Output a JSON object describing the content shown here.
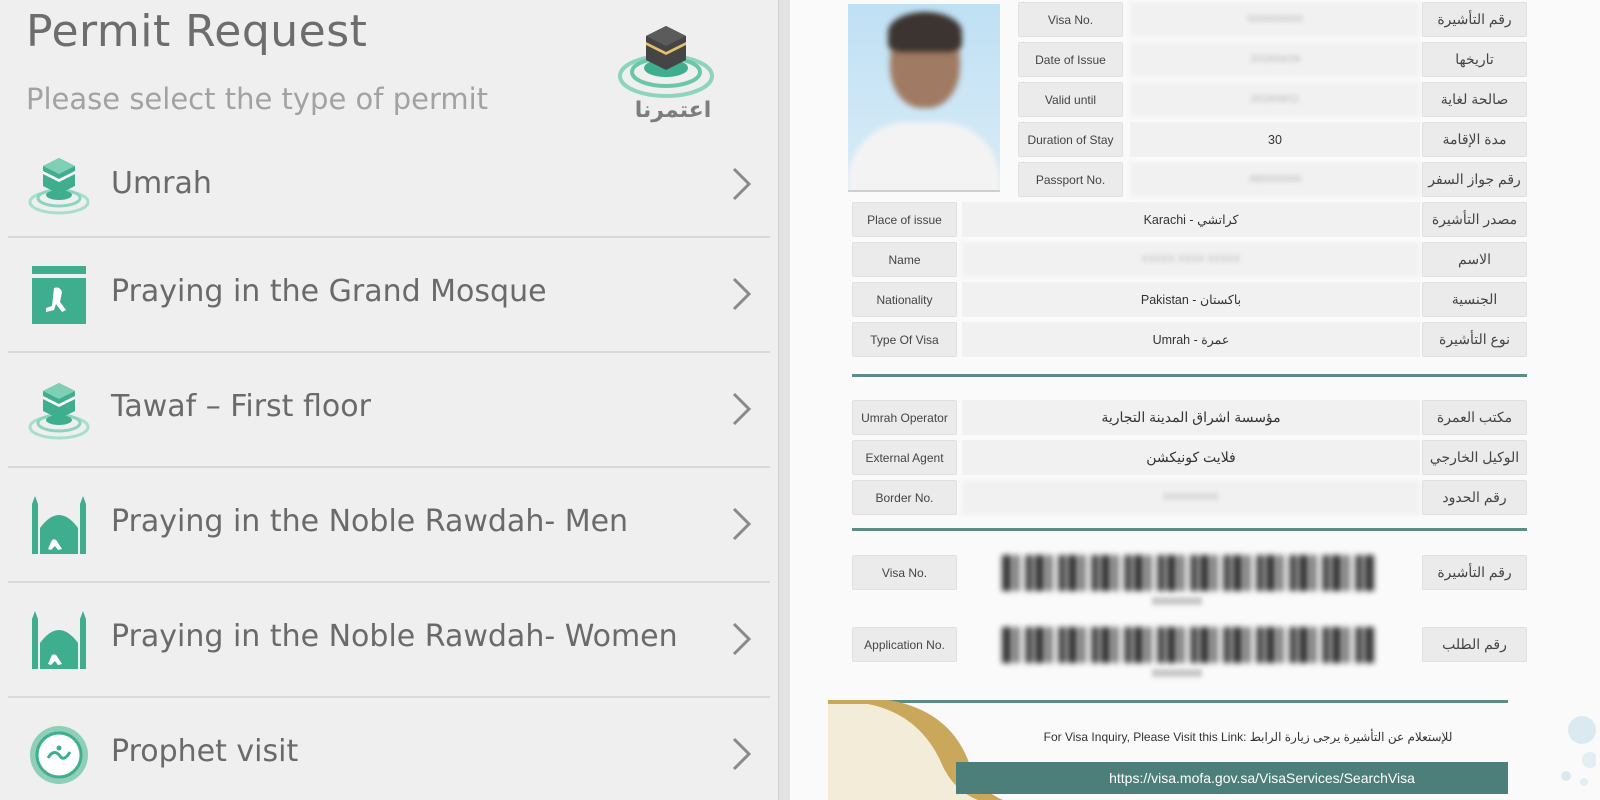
{
  "left": {
    "title": "Permit Request",
    "subtitle": "Please select the type of permit",
    "logo_text": "اعتمرنا",
    "permits": [
      {
        "label": "Umrah",
        "icon": "kaaba-icon"
      },
      {
        "label": "Praying in the Grand Mosque",
        "icon": "prayer-icon"
      },
      {
        "label": "Tawaf – First floor",
        "icon": "kaaba-icon"
      },
      {
        "label": "Praying in the Noble Rawdah- Men",
        "icon": "mosque-icon"
      },
      {
        "label": "Praying in the Noble Rawdah- Women",
        "icon": "mosque-icon"
      },
      {
        "label": "Prophet visit",
        "icon": "prophet-seal-icon"
      }
    ]
  },
  "visa": {
    "fields_top": [
      {
        "en": "Visa No.",
        "ar": "رقم التأشيرة",
        "value": "0000000000"
      },
      {
        "en": "Date of Issue",
        "ar": "تاريخها",
        "value": "2018/04/28"
      },
      {
        "en": "Valid until",
        "ar": "صالحة لغاية",
        "value": "2018/08/11"
      },
      {
        "en": "Duration of Stay",
        "ar": "مدة الإقامة",
        "value": "30"
      },
      {
        "en": "Passport No.",
        "ar": "رقم جواز السفر",
        "value": "AB0000000"
      }
    ],
    "fields_mid": [
      {
        "en": "Place of issue",
        "ar": "مصدر التأشيرة",
        "value": "Karachi - كراتشي"
      },
      {
        "en": "Name",
        "ar": "الاسم",
        "value": "XXXXX XXXX XXXXX"
      },
      {
        "en": "Nationality",
        "ar": "الجنسية",
        "value": "Pakistan - باكستان"
      },
      {
        "en": "Type Of Visa",
        "ar": "نوع التأشيرة",
        "value": "Umrah - عمرة"
      }
    ],
    "fields_agent": [
      {
        "en": "Umrah Operator",
        "ar": "مكتب العمرة",
        "value": "مؤسسة اشراق المدينة التجارية"
      },
      {
        "en": "External Agent",
        "ar": "الوكيل الخارجي",
        "value": "فلايت كونيكشن"
      },
      {
        "en": "Border No.",
        "ar": "رقم الحدود",
        "value": "0000000000"
      }
    ],
    "fields_codes": [
      {
        "en": "Visa No.",
        "ar": "رقم التأشيرة"
      },
      {
        "en": "Application No.",
        "ar": "رقم الطلب"
      }
    ],
    "inquiry_text": "For Visa Inquiry, Please Visit this Link: للإستعلام عن التأشيرة يرجى زيارة الرابط",
    "url": "https://visa.mofa.gov.sa/VisaServices/SearchVisa"
  },
  "colors": {
    "brand_green": "#3fae8e",
    "teal": "#4d7f7a",
    "gold": "#c9a85b"
  }
}
